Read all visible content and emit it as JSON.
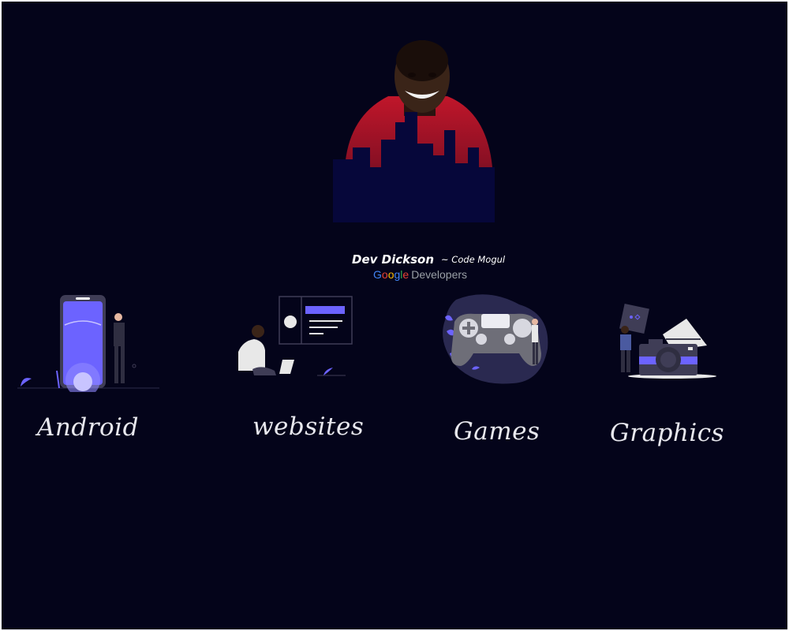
{
  "profile": {
    "name": "Dev Dickson",
    "tagline": "~ Code Mogul",
    "brand": {
      "google_letters": [
        {
          "char": "G",
          "color": "#4285F4"
        },
        {
          "char": "o",
          "color": "#EA4335"
        },
        {
          "char": "o",
          "color": "#FBBC05"
        },
        {
          "char": "g",
          "color": "#4285F4"
        },
        {
          "char": "l",
          "color": "#34A853"
        },
        {
          "char": "e",
          "color": "#EA4335"
        }
      ],
      "suffix": "Developers"
    }
  },
  "services": [
    {
      "label": "Android",
      "icon": "android-illustration"
    },
    {
      "label": "websites",
      "icon": "websites-illustration"
    },
    {
      "label": "Games",
      "icon": "games-illustration"
    },
    {
      "label": "Graphics",
      "icon": "graphics-illustration"
    }
  ],
  "colors": {
    "background": "#04041a",
    "accent": "#6c63ff",
    "text": "#ffffff"
  }
}
